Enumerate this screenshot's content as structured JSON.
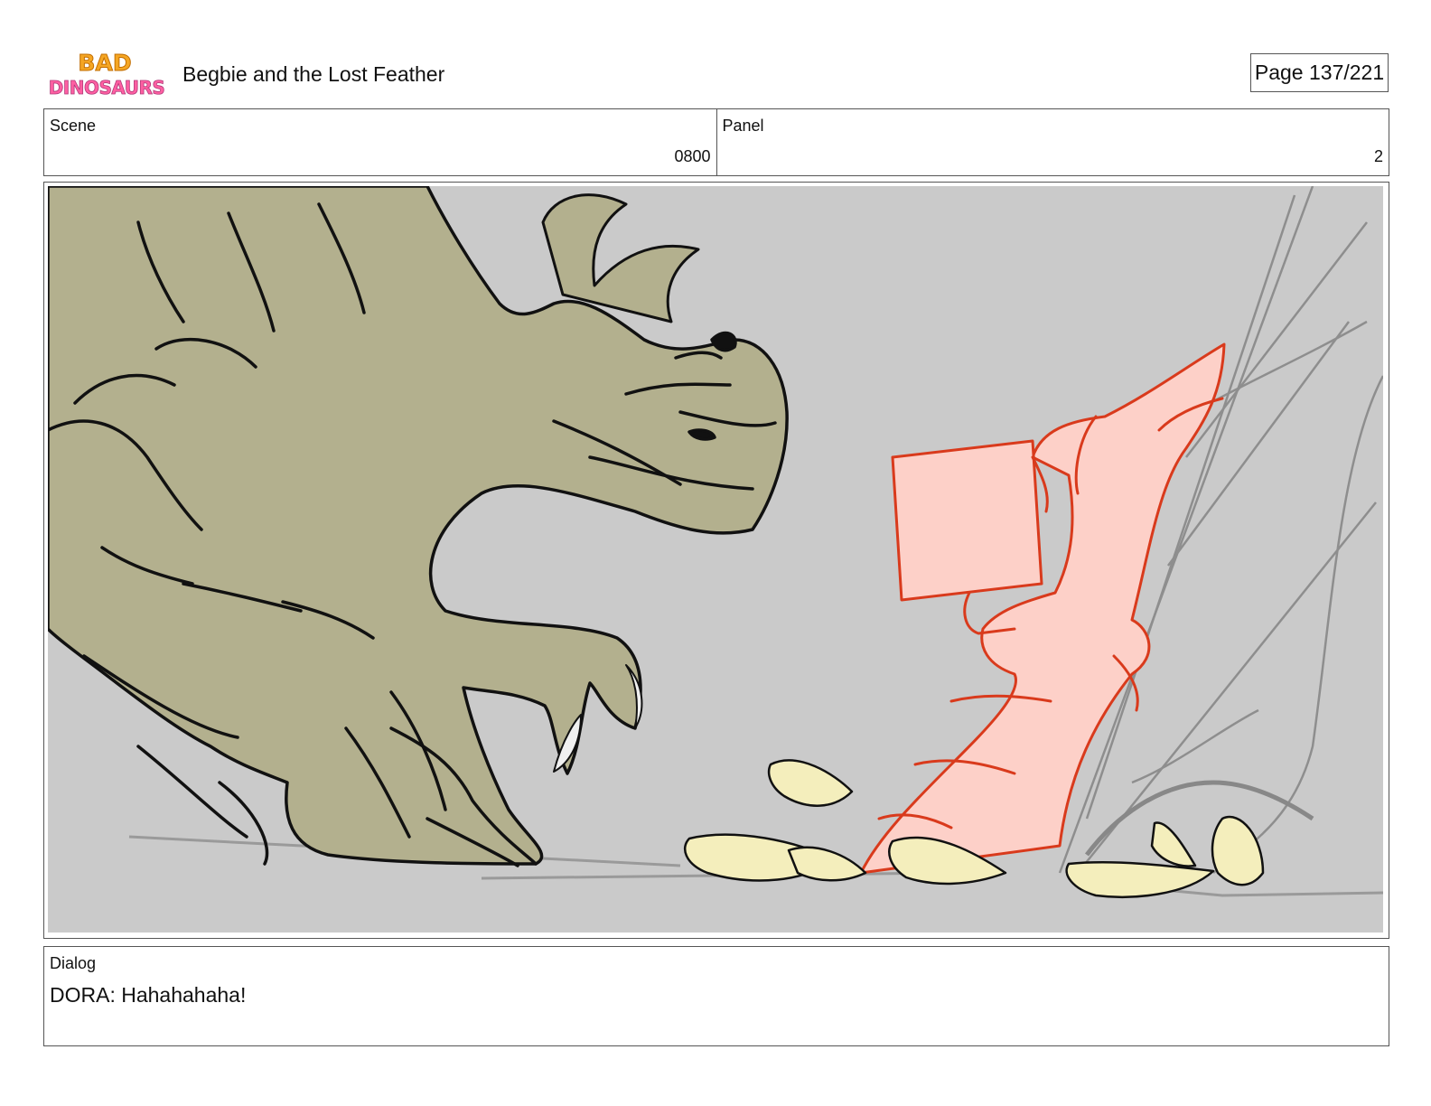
{
  "header": {
    "logo_text": "BAD DINOSAURS",
    "title": "Begbie and the Lost Feather",
    "page_indicator": "Page 137/221"
  },
  "scene": {
    "label": "Scene",
    "value": "0800"
  },
  "panel": {
    "label": "Panel",
    "value": "2"
  },
  "storyboard_frame": {
    "background_color": "#cacaca",
    "dinosaur_color": "#b3b08e",
    "pink_character_color": "#fdd0c8",
    "pink_outline_color": "#d93a1c",
    "chips_color": "#f4eebc"
  },
  "dialog": {
    "label": "Dialog",
    "text": "DORA: Hahahahaha!"
  }
}
